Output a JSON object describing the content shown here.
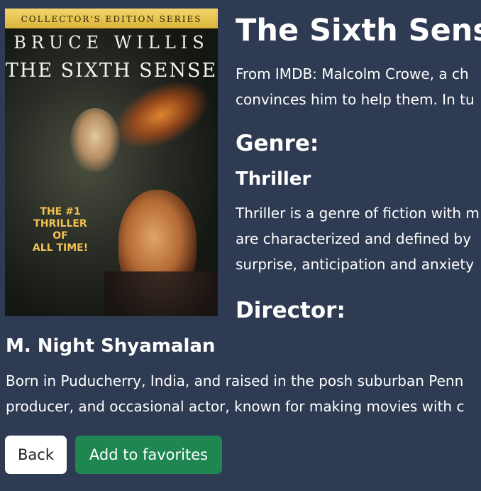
{
  "poster": {
    "banner": "COLLECTOR'S EDITION SERIES",
    "actor": "BRUCE WILLIS",
    "movie_title": "THE SIXTH SENSE",
    "tagline": [
      "THE #1",
      "THRILLER OF",
      "ALL TIME!"
    ]
  },
  "movie": {
    "title": "The Sixth Sense",
    "description_lines": [
      "From IMDB: Malcolm Crowe, a ch",
      "convinces him to help them. In tu"
    ]
  },
  "genre": {
    "heading": "Genre:",
    "name": "Thriller",
    "description_lines": [
      "Thriller is a genre of fiction with m",
      "are characterized and defined by",
      "surprise, anticipation and anxiety"
    ]
  },
  "director": {
    "heading": "Director:",
    "name": "M. Night Shyamalan",
    "bio_lines": [
      "Born in Puducherry, India, and raised in the posh suburban Penn",
      "producer, and occasional actor, known for making movies with c"
    ]
  },
  "buttons": {
    "back": "Back",
    "add_favorite": "Add to favorites"
  },
  "colors": {
    "background": "#2f3b52",
    "favorite_button": "#1e8751",
    "back_button": "#ffffff"
  }
}
